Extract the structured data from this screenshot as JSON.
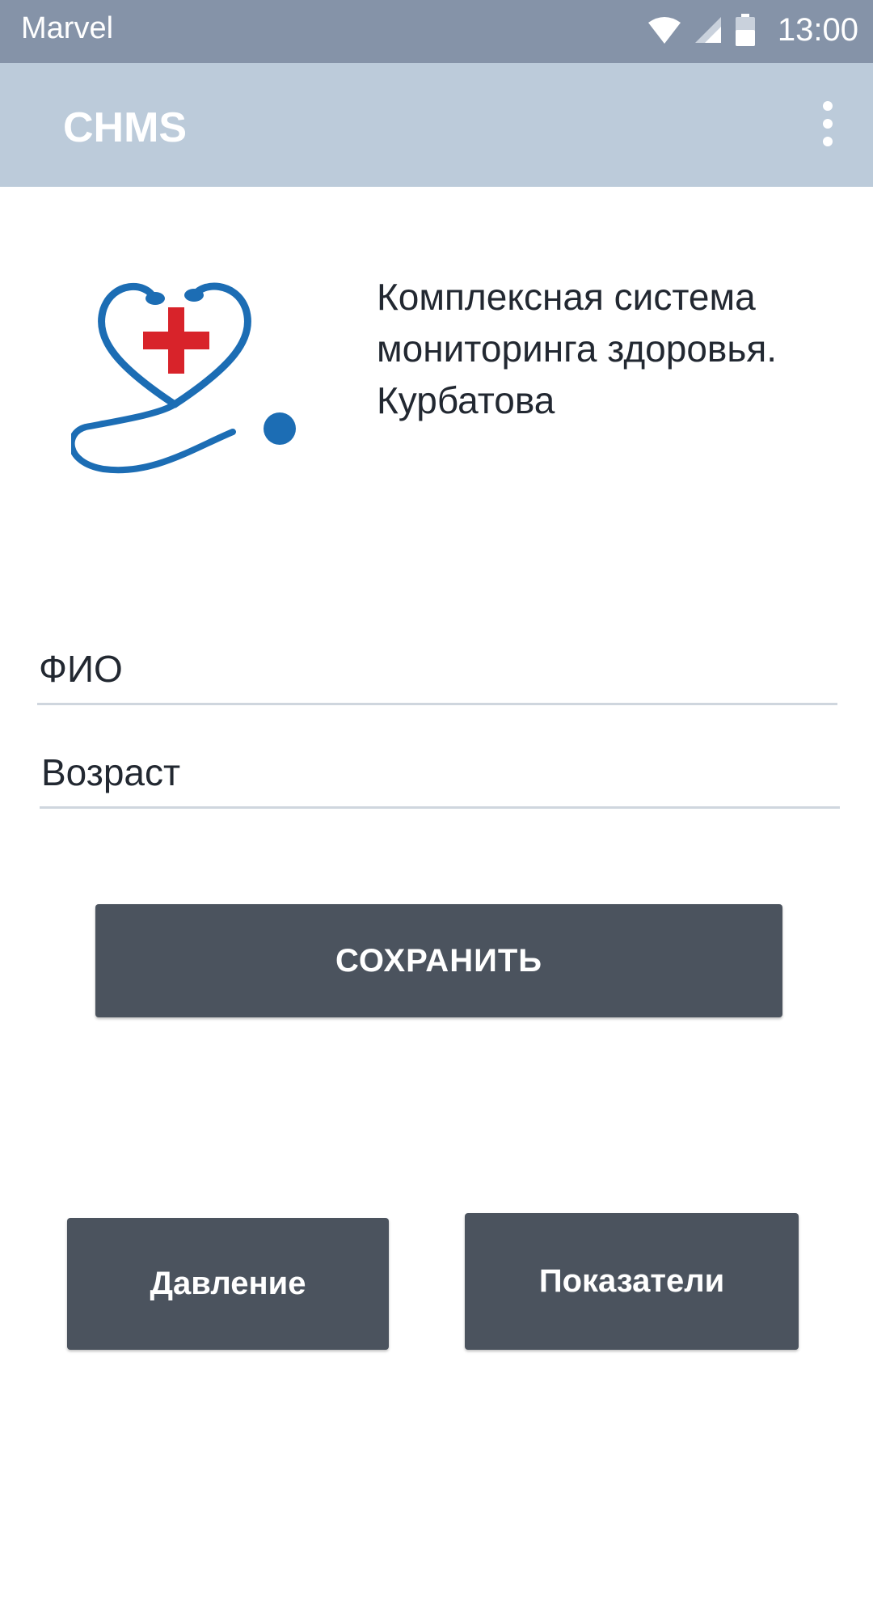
{
  "status_bar": {
    "carrier": "Marvel",
    "time": "13:00",
    "icons": [
      "wifi-icon",
      "cellular-signal-icon",
      "battery-icon"
    ]
  },
  "app_bar": {
    "title": "CHMS",
    "menu_icon": "more-vert-icon"
  },
  "header": {
    "logo_icon": "heart-stethoscope-logo",
    "description": "Комплексная система мониторинга здоровья. Курбатова"
  },
  "form": {
    "fio_placeholder": "ФИО",
    "age_placeholder": "Возраст",
    "save_label": "СОХРАНИТЬ"
  },
  "nav": {
    "pressure_label": "Давление",
    "metrics_label": "Показатели"
  },
  "colors": {
    "status_bar": "#8593a8",
    "app_bar": "#bccbda",
    "button": "#4b535e",
    "logo_blue": "#1c6db4",
    "logo_red": "#d8232a"
  }
}
